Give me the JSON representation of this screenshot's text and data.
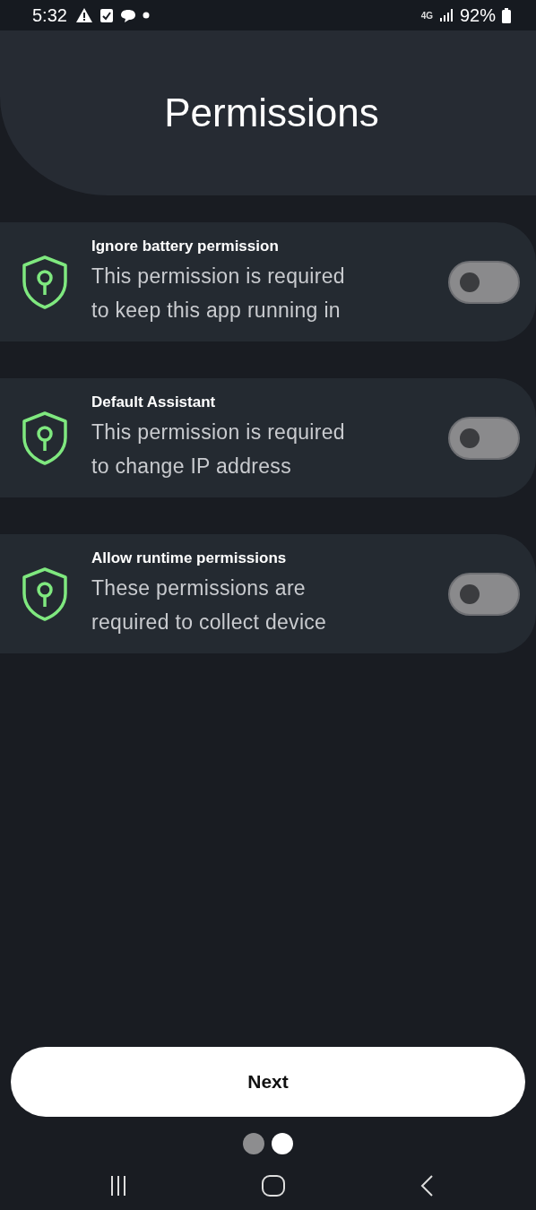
{
  "status_bar": {
    "time": "5:32",
    "network": "4G",
    "battery": "92%"
  },
  "header": {
    "title": "Permissions"
  },
  "permissions": [
    {
      "title": "Ignore battery permission",
      "description": "This permission is required\nto keep this app running in",
      "on": false
    },
    {
      "title": "Default Assistant",
      "description": "This permission is required\nto change IP address",
      "on": false
    },
    {
      "title": "Allow runtime permissions",
      "description": "These permissions are\nrequired to collect device",
      "on": false
    }
  ],
  "next_button": {
    "label": "Next"
  },
  "pager": [
    {
      "selected": false
    },
    {
      "selected": true
    }
  ]
}
